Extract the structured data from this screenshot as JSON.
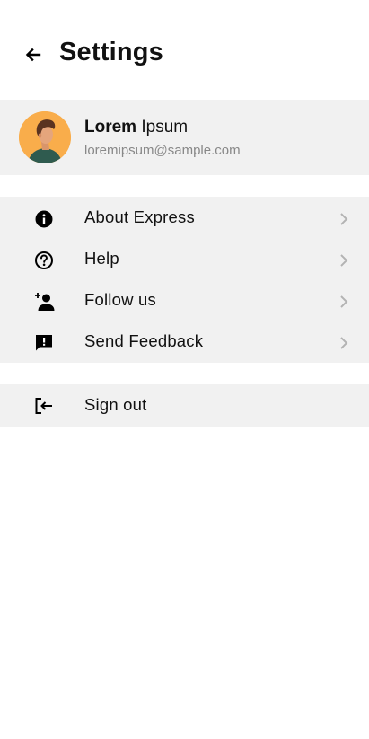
{
  "header": {
    "title": "Settings",
    "back_icon": "arrow-back-icon"
  },
  "profile": {
    "first_name": "Lorem",
    "last_name": "Ipsum",
    "email": "loremipsum@sample.com",
    "avatar_bg": "#f9ad4b"
  },
  "menu": {
    "items": [
      {
        "label": "About Express",
        "icon": "info-icon"
      },
      {
        "label": "Help",
        "icon": "help-circle-icon"
      },
      {
        "label": "Follow us",
        "icon": "person-add-icon"
      },
      {
        "label": "Send Feedback",
        "icon": "feedback-icon"
      }
    ],
    "chevron_color": "#b3b3b3"
  },
  "signout": {
    "label": "Sign out",
    "icon": "logout-icon"
  },
  "colors": {
    "panel_bg": "#f1f1f1",
    "text": "#111111",
    "muted": "#888888"
  }
}
